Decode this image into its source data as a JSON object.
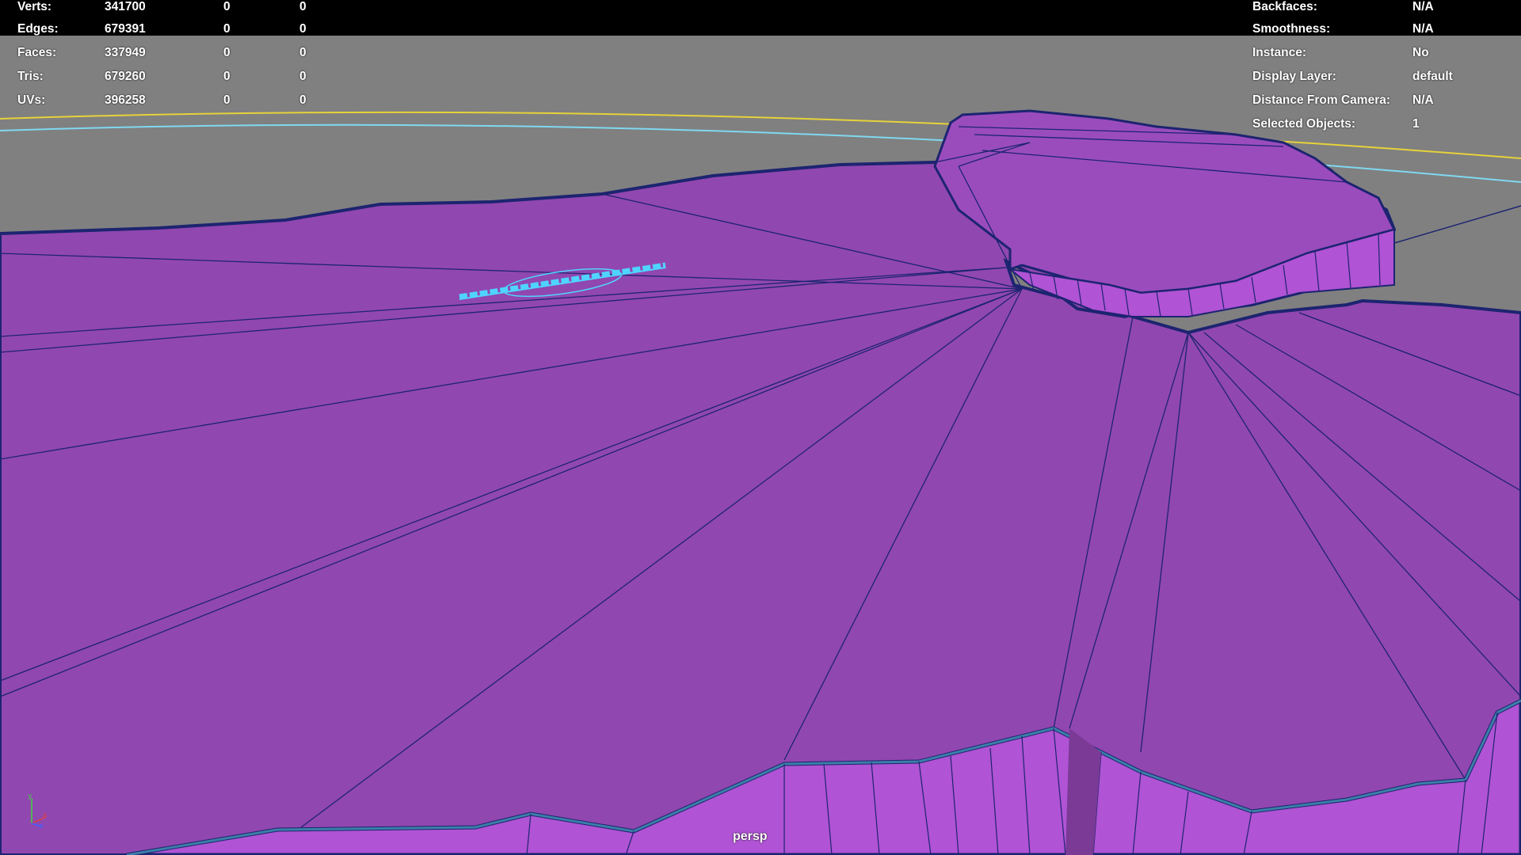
{
  "app": {
    "view_name": "persp"
  },
  "poly_count": {
    "rows": [
      {
        "label": "Verts:",
        "total": "341700",
        "selected": "0",
        "selected_2": "0"
      },
      {
        "label": "Edges:",
        "total": "679391",
        "selected": "0",
        "selected_2": "0"
      },
      {
        "label": "Faces:",
        "total": "337949",
        "selected": "0",
        "selected_2": "0"
      },
      {
        "label": "Tris:",
        "total": "679260",
        "selected": "0",
        "selected_2": "0"
      },
      {
        "label": "UVs:",
        "total": "396258",
        "selected": "0",
        "selected_2": "0"
      }
    ]
  },
  "object_details": {
    "rows": [
      {
        "label": "Backfaces:",
        "value": "N/A"
      },
      {
        "label": "Smoothness:",
        "value": "N/A"
      },
      {
        "label": "Instance:",
        "value": "No"
      },
      {
        "label": "Display Layer:",
        "value": "default"
      },
      {
        "label": "Distance From Camera:",
        "value": "N/A"
      },
      {
        "label": "Selected Objects:",
        "value": "1"
      }
    ]
  },
  "axis": {
    "x": "x",
    "y": "y",
    "z": "z"
  },
  "colors": {
    "background": "#808080",
    "mesh_fill": "#9147b0",
    "mesh_side": "#a84fc8",
    "wire": "#1d2470",
    "selection": "#4fd4ff",
    "grid_yellow": "#e6d23a",
    "grid_cyan": "#7fd8f0"
  }
}
